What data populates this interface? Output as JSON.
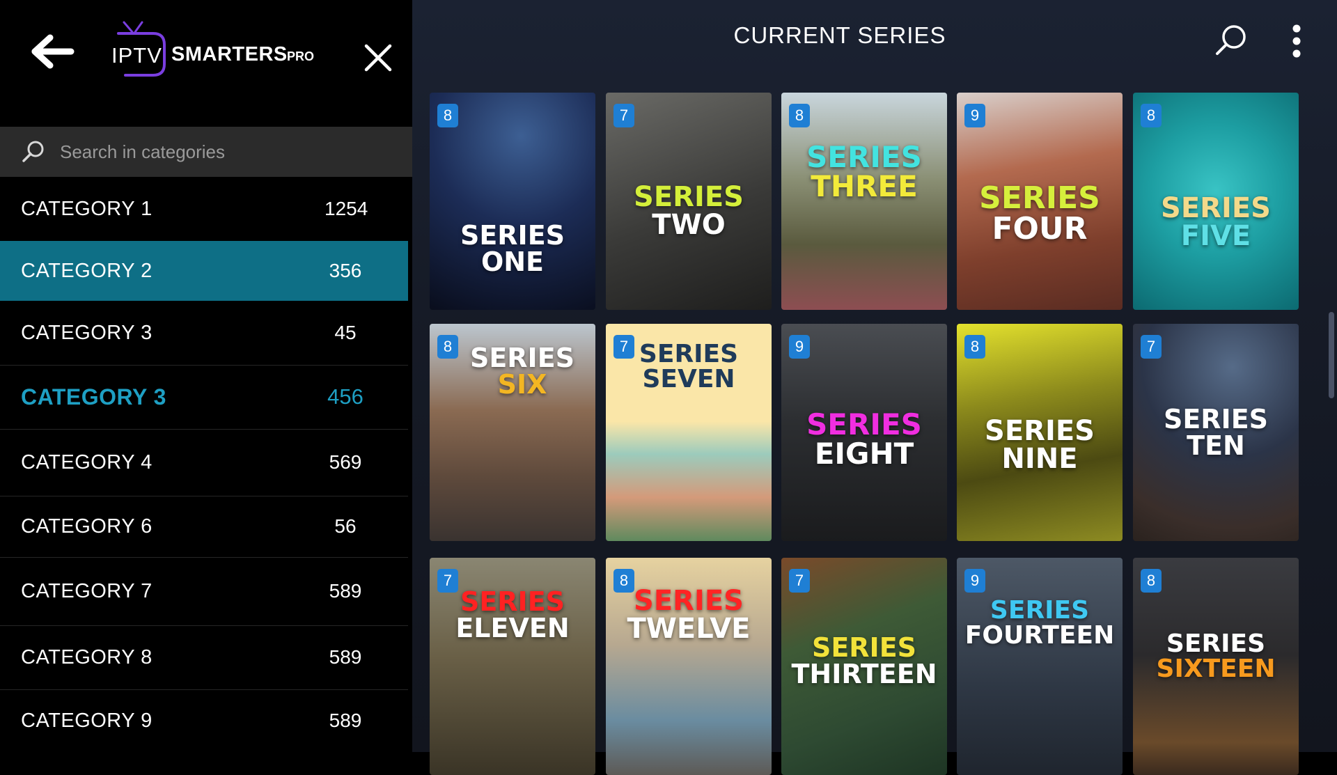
{
  "header": {
    "logo_iptv": "IPTV",
    "logo_smarters": "SMARTERS",
    "logo_pro": "PRO",
    "title": "CURRENT SERIES"
  },
  "search": {
    "placeholder": "Search in categories"
  },
  "categories": [
    {
      "label": "CATEGORY  1",
      "count": "1254"
    },
    {
      "label": "CATEGORY  2",
      "count": "356"
    },
    {
      "label": "CATEGORY  3",
      "count": "45"
    },
    {
      "label": "CATEGORY 3",
      "count": "456"
    },
    {
      "label": "CATEGORY  4",
      "count": "569"
    },
    {
      "label": "CATEGORY  6",
      "count": "56"
    },
    {
      "label": "CATEGORY  7",
      "count": "589"
    },
    {
      "label": "CATEGORY  8",
      "count": "589"
    },
    {
      "label": "CATEGORY  9",
      "count": "589"
    }
  ],
  "series": [
    {
      "badge": "8",
      "line1": "SERIES",
      "line2": "ONE",
      "c1": "#ffffff",
      "c2": "#ffffff"
    },
    {
      "badge": "7",
      "line1": "SERIES",
      "line2": "TWO",
      "c1": "#d4ef3a",
      "c2": "#ffffff"
    },
    {
      "badge": "8",
      "line1": "SERIES",
      "line2": "THREE",
      "c1": "#43e3e0",
      "c2": "#f2ea3a"
    },
    {
      "badge": "9",
      "line1": "SERIES",
      "line2": "FOUR",
      "c1": "#d6ef3c",
      "c2": "#ffffff"
    },
    {
      "badge": "8",
      "line1": "SERIES",
      "line2": "FIVE",
      "c1": "#f3d98a",
      "c2": "#5fe0e6"
    },
    {
      "badge": "8",
      "line1": "SERIES",
      "line2": "SIX",
      "c1": "#ffffff",
      "c2": "#f3b623"
    },
    {
      "badge": "7",
      "line1": "SERIES",
      "line2": "SEVEN",
      "c1": "#1f3b5a",
      "c2": "#1f3b5a"
    },
    {
      "badge": "9",
      "line1": "SERIES",
      "line2": "EIGHT",
      "c1": "#f02ee0",
      "c2": "#ffffff"
    },
    {
      "badge": "8",
      "line1": "SERIES",
      "line2": "NINE",
      "c1": "#ffffff",
      "c2": "#ffffff"
    },
    {
      "badge": "7",
      "line1": "SERIES",
      "line2": "TEN",
      "c1": "#ffffff",
      "c2": "#ffffff"
    },
    {
      "badge": "7",
      "line1": "SERIES",
      "line2": "ELEVEN",
      "c1": "#ff2222",
      "c2": "#ffffff"
    },
    {
      "badge": "8",
      "line1": "SERIES",
      "line2": "TWELVE",
      "c1": "#ff2424",
      "c2": "#ffffff"
    },
    {
      "badge": "7",
      "line1": "SERIES",
      "line2": "THIRTEEN",
      "c1": "#f2e23a",
      "c2": "#ffffff"
    },
    {
      "badge": "9",
      "line1": "SERIES",
      "line2": "FOURTEEN",
      "c1": "#3fc8f2",
      "c2": "#ffffff"
    },
    {
      "badge": "8",
      "line1": "SERIES",
      "line2": "SIXTEEN",
      "c1": "#ffffff",
      "c2": "#f79a1e"
    }
  ],
  "colors": {
    "selected": "#0e6f86",
    "accent": "#1e9fc3",
    "badge": "#1f7fd4"
  },
  "icons": {
    "back": "arrow-left-icon",
    "close": "close-icon",
    "search": "search-icon",
    "more": "more-vertical-icon",
    "logo": "tv-icon"
  }
}
